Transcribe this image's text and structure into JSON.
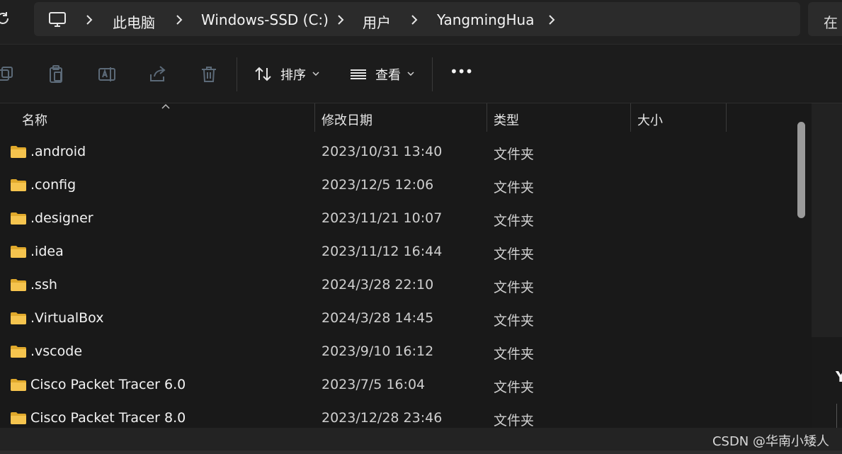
{
  "breadcrumb": {
    "items": [
      "此电脑",
      "Windows-SSD (C:)",
      "用户",
      "YangmingHua"
    ]
  },
  "search": {
    "placeholder_visible": "在"
  },
  "toolbar": {
    "sort_label": "排序",
    "view_label": "查看",
    "more_label": "•••"
  },
  "columns": {
    "name": "名称",
    "modified": "修改日期",
    "type": "类型",
    "size": "大小"
  },
  "files": [
    {
      "name": ".android",
      "modified": "2023/10/31 13:40",
      "type": "文件夹"
    },
    {
      "name": ".config",
      "modified": "2023/12/5 12:06",
      "type": "文件夹"
    },
    {
      "name": ".designer",
      "modified": "2023/11/21 10:07",
      "type": "文件夹"
    },
    {
      "name": ".idea",
      "modified": "2023/11/12 16:44",
      "type": "文件夹"
    },
    {
      "name": ".ssh",
      "modified": "2024/3/28 22:10",
      "type": "文件夹"
    },
    {
      "name": ".VirtualBox",
      "modified": "2024/3/28 14:45",
      "type": "文件夹"
    },
    {
      "name": ".vscode",
      "modified": "2023/9/10 16:12",
      "type": "文件夹"
    },
    {
      "name": "Cisco Packet Tracer 6.0",
      "modified": "2023/7/5 16:04",
      "type": "文件夹"
    },
    {
      "name": "Cisco Packet Tracer 8.0",
      "modified": "2023/12/28 23:46",
      "type": "文件夹"
    }
  ],
  "side_panel": {
    "letter": "Y"
  },
  "watermark": "CSDN @华南小矮人",
  "colors": {
    "background": "#191919",
    "folder": "#f5c44e",
    "accent_icon": "#5aa0e0",
    "text": "#f3f3f3"
  },
  "icons": {
    "refresh": "refresh-icon",
    "computer": "computer-icon",
    "copy": "copy-icon",
    "paste": "paste-icon",
    "rename": "rename-icon",
    "share": "share-icon",
    "delete": "trash-icon",
    "sort": "sort-icon",
    "view": "view-list-icon",
    "folder": "folder-icon"
  }
}
